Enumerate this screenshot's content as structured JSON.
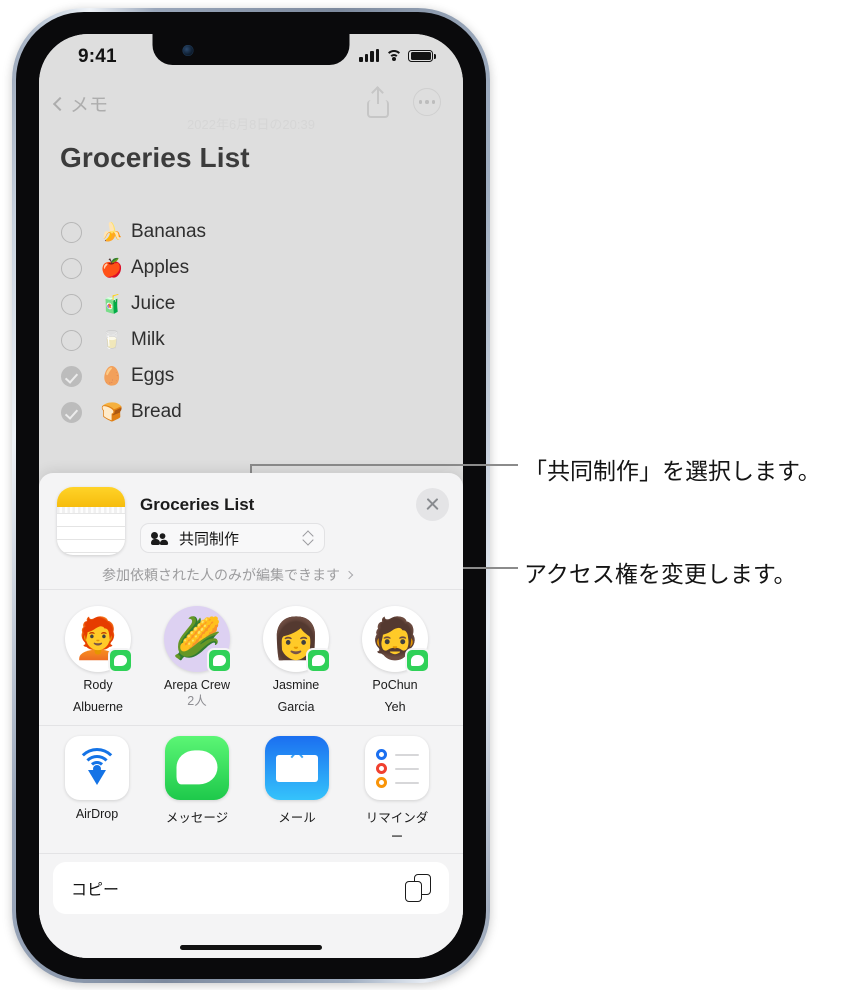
{
  "status_bar": {
    "time": "9:41",
    "signal_icon": "cellular-bars-icon",
    "wifi_icon": "wifi-icon",
    "battery_icon": "battery-full-icon"
  },
  "notes_app": {
    "back_label": "メモ",
    "date_label": "2022年6月8日の20:39",
    "share_icon": "share-icon",
    "more_icon": "more-ellipsis-icon",
    "note_title": "Groceries List",
    "checklist": [
      {
        "emoji": "🍌",
        "label": "Bananas",
        "checked": false
      },
      {
        "emoji": "🍎",
        "label": "Apples",
        "checked": false
      },
      {
        "emoji": "🧃",
        "label": "Juice",
        "checked": false
      },
      {
        "emoji": "🥛",
        "label": "Milk",
        "checked": false
      },
      {
        "emoji": "🥚",
        "label": "Eggs",
        "checked": true
      },
      {
        "emoji": "🍞",
        "label": "Bread",
        "checked": true
      }
    ]
  },
  "share_sheet": {
    "app_icon": "notes-app-icon",
    "title": "Groceries List",
    "close_icon": "close-icon",
    "option_pill": {
      "icon": "people-icon",
      "label": "共同制作",
      "selector_icon": "up-down-chevron-icon"
    },
    "permission_label": "参加依頼された人のみが編集できます",
    "permission_chevron": "chevron-right-icon",
    "contacts": [
      {
        "name_line1": "Rody",
        "name_line2": "Albuerne",
        "sub": "",
        "emoji": "🧑‍🦰",
        "avatar_style": "white",
        "badge": "messages-badge-icon"
      },
      {
        "name_line1": "Arepa Crew",
        "name_line2": "",
        "sub": "2人",
        "emoji": "🌽",
        "avatar_style": "purple",
        "badge": "messages-badge-icon"
      },
      {
        "name_line1": "Jasmine",
        "name_line2": "Garcia",
        "sub": "",
        "emoji": "👩",
        "avatar_style": "white",
        "badge": "messages-badge-icon"
      },
      {
        "name_line1": "PoChun",
        "name_line2": "Yeh",
        "sub": "",
        "emoji": "🧔",
        "avatar_style": "white",
        "badge": "messages-badge-icon"
      }
    ],
    "apps": [
      {
        "label": "AirDrop",
        "icon": "airdrop-icon"
      },
      {
        "label": "メッセージ",
        "icon": "messages-icon"
      },
      {
        "label": "メール",
        "icon": "mail-icon"
      },
      {
        "label": "リマインダー",
        "icon": "reminders-icon"
      }
    ],
    "copy_action": {
      "label": "コピー",
      "icon": "copy-icon"
    }
  },
  "annotations": [
    {
      "text": "「共同制作」を選択します。"
    },
    {
      "text": "アクセス権を変更します。"
    }
  ],
  "colors": {
    "notes_background": "#dedede",
    "sheet_background": "#f4f4f5",
    "accent_yellow": "#ffd328",
    "messages_green": "#2fd158",
    "mail_blue": "#1b6ff0",
    "callout_line": "#8b8b8b"
  }
}
